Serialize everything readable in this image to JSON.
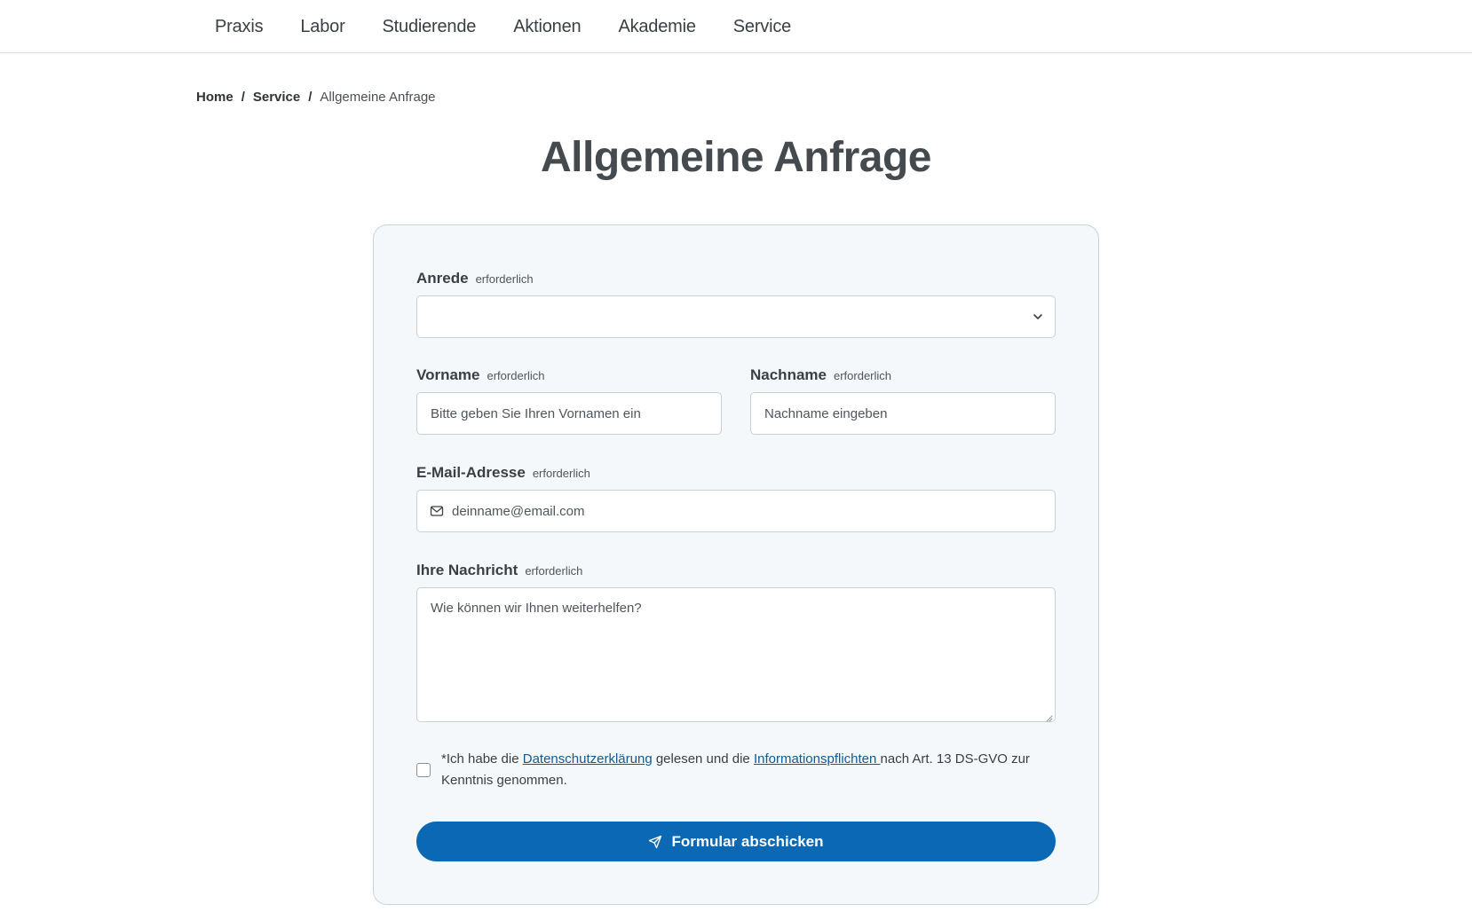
{
  "nav": {
    "items": [
      "Praxis",
      "Labor",
      "Studierende",
      "Aktionen",
      "Akademie",
      "Service"
    ]
  },
  "breadcrumb": {
    "home": "Home",
    "separator": "/",
    "service": "Service",
    "current": "Allgemeine Anfrage"
  },
  "page": {
    "title": "Allgemeine Anfrage"
  },
  "form": {
    "required_label": "erforderlich",
    "salutation": {
      "label": "Anrede",
      "value": ""
    },
    "first_name": {
      "label": "Vorname",
      "placeholder": "Bitte geben Sie Ihren Vornamen ein"
    },
    "last_name": {
      "label": "Nachname",
      "placeholder": "Nachname eingeben"
    },
    "email": {
      "label": "E-Mail-Adresse",
      "placeholder": "deinname@email.com"
    },
    "message": {
      "label": "Ihre Nachricht",
      "placeholder": "Wie können wir Ihnen weiterhelfen?"
    },
    "consent": {
      "text_before": "*Ich habe die ",
      "privacy_link": "Datenschutzerklärung",
      "text_middle": " gelesen und die ",
      "info_link": "Informationspflichten ",
      "text_after": "nach Art. 13 DS-GVO zur Kenntnis genommen.",
      "checked": false
    },
    "submit_label": "Formular abschicken"
  },
  "colors": {
    "primary": "#0a68b4",
    "link": "#0b5c99",
    "card_bg": "#f5f8fa"
  }
}
